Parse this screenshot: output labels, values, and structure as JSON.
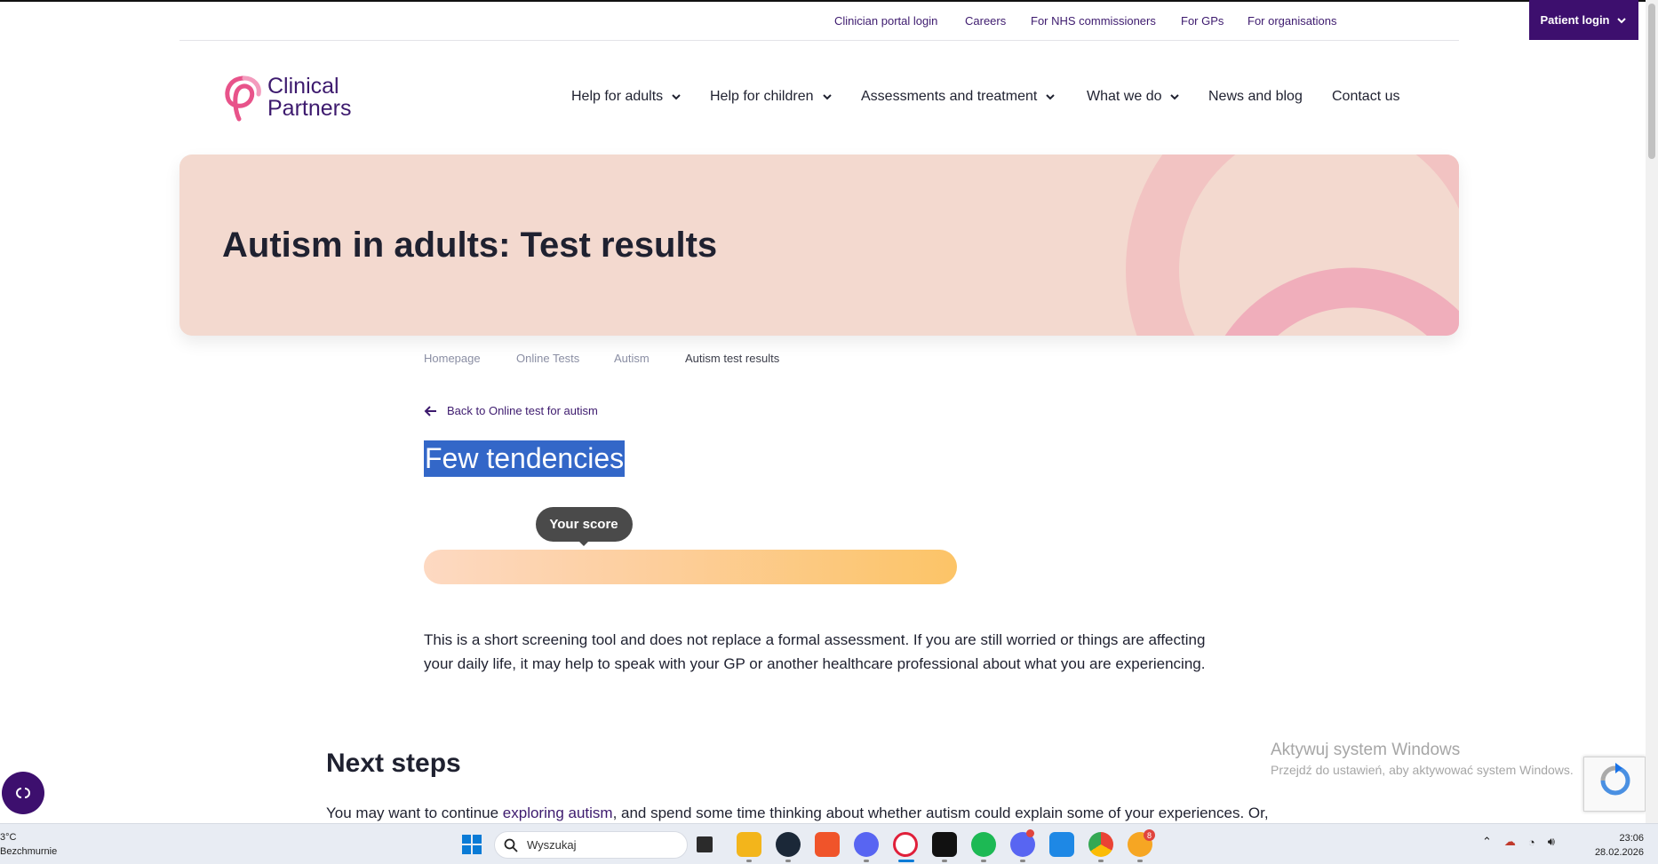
{
  "utility_nav": {
    "links": [
      "Clinician portal login",
      "Careers",
      "For NHS commissioners",
      "For GPs",
      "For organisations"
    ],
    "patient_login": "Patient login"
  },
  "logo": {
    "line1": "Clinical",
    "line2": "Partners"
  },
  "main_nav": {
    "items": [
      "Help for adults",
      "Help for children",
      "Assessments and treatment",
      "What we do",
      "News and blog",
      "Contact us"
    ]
  },
  "hero": {
    "title": "Autism in adults: Test results"
  },
  "breadcrumb": [
    "Homepage",
    "Online Tests",
    "Autism",
    "Autism test results"
  ],
  "back_link": "Back to Online test for autism",
  "result": {
    "heading": "Few tendencies",
    "score_label": "Your score",
    "score_fraction": 0.3
  },
  "disclaimer": "This is a short screening tool and does not replace a formal assessment. If you are still worried or things are affecting your daily life, it may help to speak with your GP or another healthcare professional about what you are experiencing.",
  "next_steps": {
    "heading": "Next steps",
    "text_before": "You may want to continue ",
    "link": "exploring autism",
    "text_after": ", and spend some time thinking about whether autism could explain some of your experiences. Or,"
  },
  "activation": {
    "title": "Aktywuj system Windows",
    "subtitle": "Przejdź do ustawień, aby aktywować system Windows."
  },
  "taskbar": {
    "weather_temp": "3°C",
    "weather_text": "Bezchmurnie",
    "search_placeholder": "Wyszukaj",
    "time": "23:06",
    "date": "28.02.2026",
    "badges": {
      "discord2": "",
      "chat": "8"
    }
  },
  "colors": {
    "brand_purple": "#3d0f6e",
    "hero_bg": "#f3d9cf",
    "selection": "#3367c8",
    "score_start": "#fdd9c2",
    "score_end": "#fcc467"
  }
}
